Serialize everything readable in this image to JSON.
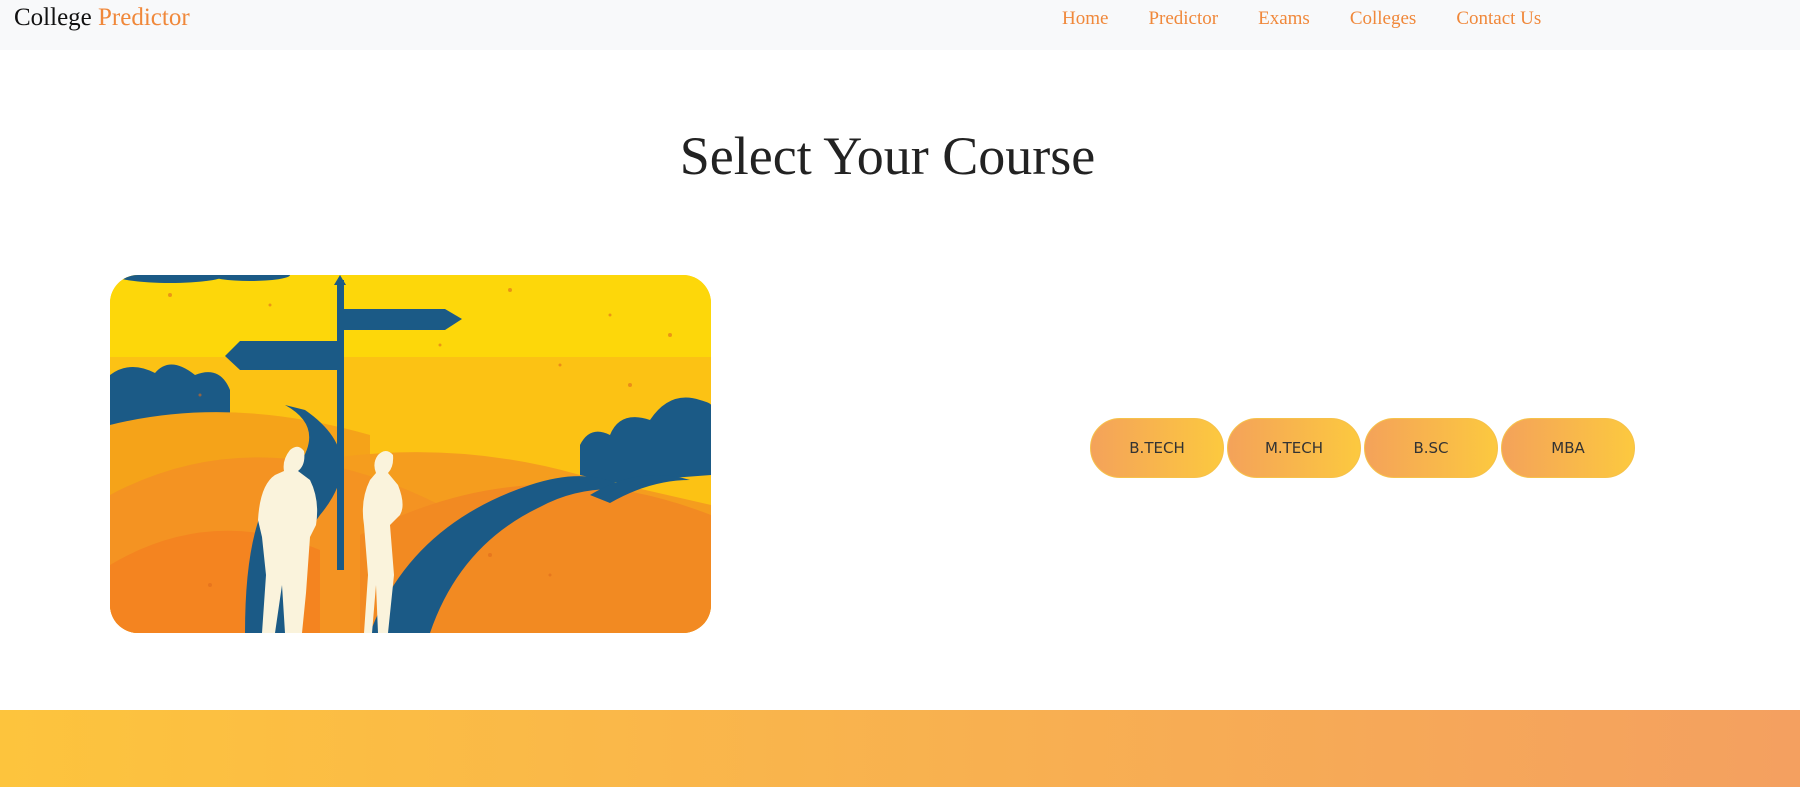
{
  "nav": {
    "brand_primary": "College",
    "brand_accent": "Predictor",
    "links": [
      {
        "label": "Home"
      },
      {
        "label": "Predictor"
      },
      {
        "label": "Exams"
      },
      {
        "label": "Colleges"
      },
      {
        "label": "Contact Us"
      }
    ]
  },
  "main": {
    "title": "Select Your Course",
    "illustration": "crossroads-signpost-illustration",
    "courses": [
      {
        "label": "B.TECH"
      },
      {
        "label": "M.TECH"
      },
      {
        "label": "B.SC"
      },
      {
        "label": "MBA"
      }
    ]
  },
  "colors": {
    "accent": "#f0883a",
    "button_gradient_start": "#f4a25a",
    "button_gradient_end": "#fcc93f",
    "footer_gradient_start": "#fdc43d",
    "footer_gradient_end": "#f4a060"
  }
}
